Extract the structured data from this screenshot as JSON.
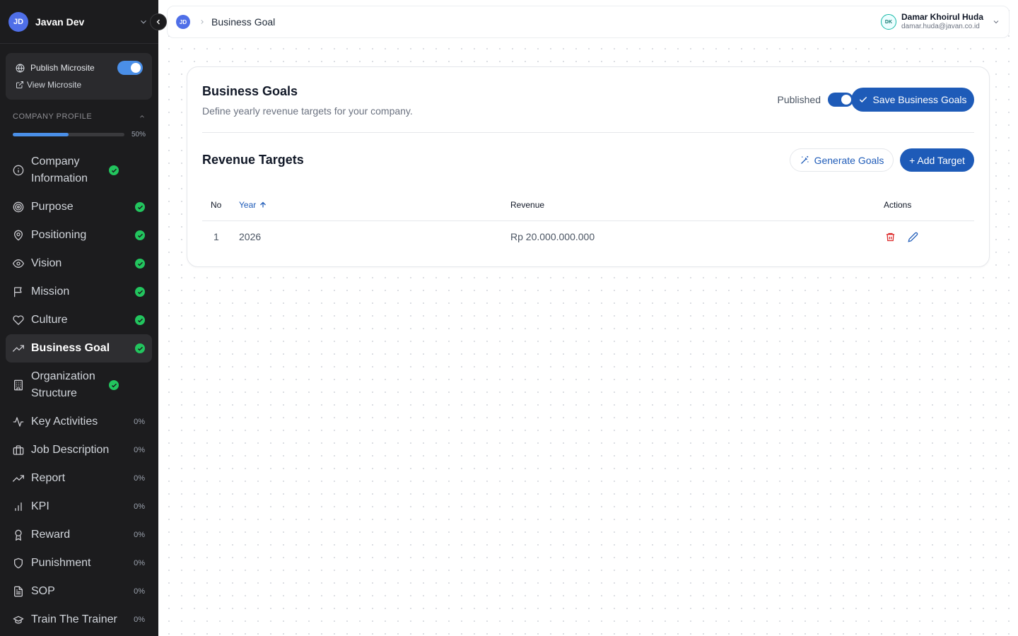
{
  "workspace": {
    "initials": "JD",
    "name": "Javan Dev"
  },
  "publish": {
    "publish_label": "Publish Microsite",
    "view_label": "View Microsite",
    "enabled": true
  },
  "profile": {
    "section_label": "COMPANY PROFILE",
    "progress": 0.5,
    "progress_label": "50%"
  },
  "nav": {
    "items": [
      {
        "label": "Company Information",
        "icon": "info-icon",
        "status": "complete"
      },
      {
        "label": "Purpose",
        "icon": "target-icon",
        "status": "complete"
      },
      {
        "label": "Positioning",
        "icon": "map-pin-icon",
        "status": "complete"
      },
      {
        "label": "Vision",
        "icon": "eye-icon",
        "status": "complete"
      },
      {
        "label": "Mission",
        "icon": "flag-icon",
        "status": "complete"
      },
      {
        "label": "Culture",
        "icon": "heart-icon",
        "status": "complete"
      },
      {
        "label": "Business Goal",
        "icon": "trending-up-icon",
        "status": "complete",
        "active": true
      },
      {
        "label": "Organization Structure",
        "icon": "building-icon",
        "status": "complete"
      },
      {
        "label": "Key Activities",
        "icon": "activity-icon",
        "status": "0%"
      },
      {
        "label": "Job Description",
        "icon": "briefcase-icon",
        "status": "0%"
      },
      {
        "label": "Report",
        "icon": "trending-up-icon",
        "status": "0%"
      },
      {
        "label": "KPI",
        "icon": "bar-chart-icon",
        "status": "0%"
      },
      {
        "label": "Reward",
        "icon": "award-icon",
        "status": "0%"
      },
      {
        "label": "Punishment",
        "icon": "shield-icon",
        "status": "0%"
      },
      {
        "label": "SOP",
        "icon": "file-text-icon",
        "status": "0%"
      },
      {
        "label": "Train The Trainer",
        "icon": "graduation-cap-icon",
        "status": "0%"
      }
    ]
  },
  "topbar": {
    "avatar_initials": "JD",
    "breadcrumb": "Business Goal",
    "user": {
      "initials": "DK",
      "name": "Damar Khoirul Huda",
      "email": "damar.huda@javan.co.id"
    }
  },
  "page": {
    "title": "Business Goals",
    "subtitle": "Define yearly revenue targets for your company.",
    "published_label": "Published",
    "save_label": "Save Business Goals",
    "section_title": "Revenue Targets",
    "generate_label": "Generate Goals",
    "add_label": "+ Add Target"
  },
  "table": {
    "columns": {
      "no": "No",
      "year": "Year",
      "revenue": "Revenue",
      "actions": "Actions"
    },
    "rows": [
      {
        "no": "1",
        "year": "2026",
        "revenue": "Rp 20.000.000.000"
      }
    ]
  },
  "colors": {
    "sidebar_bg": "#1c1c1e",
    "accent": "#1e5bb8",
    "success": "#22c55e",
    "danger": "#dc2626"
  }
}
